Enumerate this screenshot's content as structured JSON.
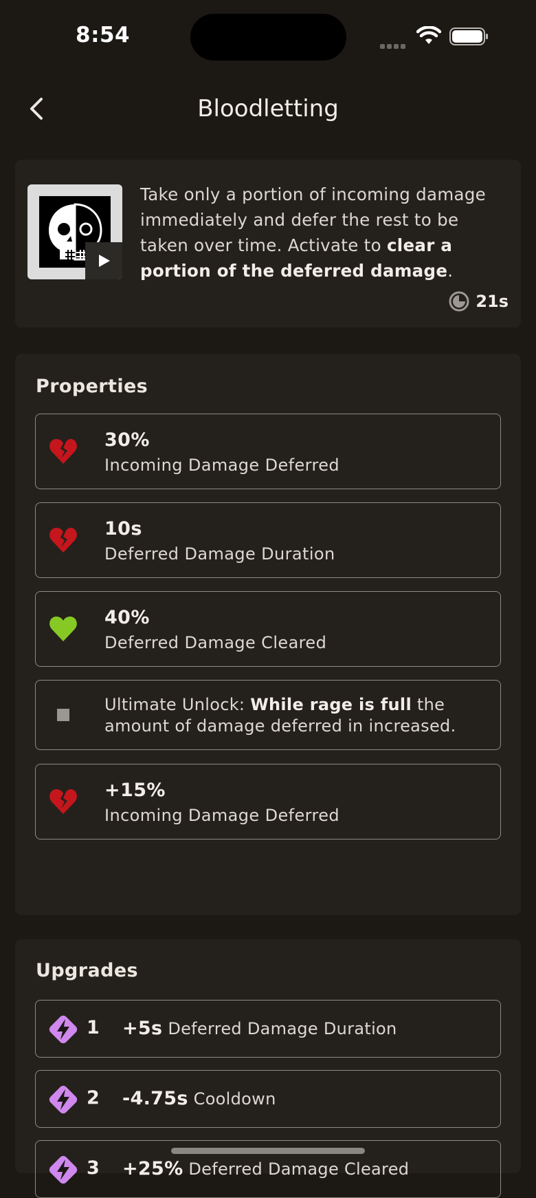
{
  "status_bar": {
    "time": "8:54"
  },
  "header": {
    "title": "Bloodletting"
  },
  "ability": {
    "description_plain_1": "Take only a portion of incoming damage immediately and defer the rest to be taken over time. Activate to ",
    "description_bold": "clear a portion of the deferred damage",
    "description_plain_2": ".",
    "cooldown": "21s"
  },
  "properties": {
    "title": "Properties",
    "items": [
      {
        "value": "30%",
        "label": "Incoming Damage Deferred",
        "icon": "broken-heart-icon"
      },
      {
        "value": "10s",
        "label": "Deferred Damage Duration",
        "icon": "broken-heart-icon"
      },
      {
        "value": "40%",
        "label": "Deferred Damage Cleared",
        "icon": "heart-icon"
      },
      {
        "ult_prefix": "Ultimate Unlock: ",
        "ult_bold": "While rage is full",
        "ult_suffix": " the amount of damage deferred in increased.",
        "icon": "square-icon"
      },
      {
        "value": "+15%",
        "label": "Incoming Damage Deferred",
        "icon": "broken-heart-icon"
      }
    ]
  },
  "upgrades": {
    "title": "Upgrades",
    "items": [
      {
        "num": "1",
        "amount": "+5s",
        "label": " Deferred Damage Duration"
      },
      {
        "num": "2",
        "amount": "-4.75s",
        "label": " Cooldown"
      },
      {
        "num": "3",
        "amount": "+25%",
        "label": " Deferred Damage Cleared"
      }
    ]
  },
  "colors": {
    "background": "#1c1915",
    "card": "#24211c",
    "broken_heart": "#c4161c",
    "heart": "#86c924",
    "upgrade_icon": "#cf88ee"
  }
}
